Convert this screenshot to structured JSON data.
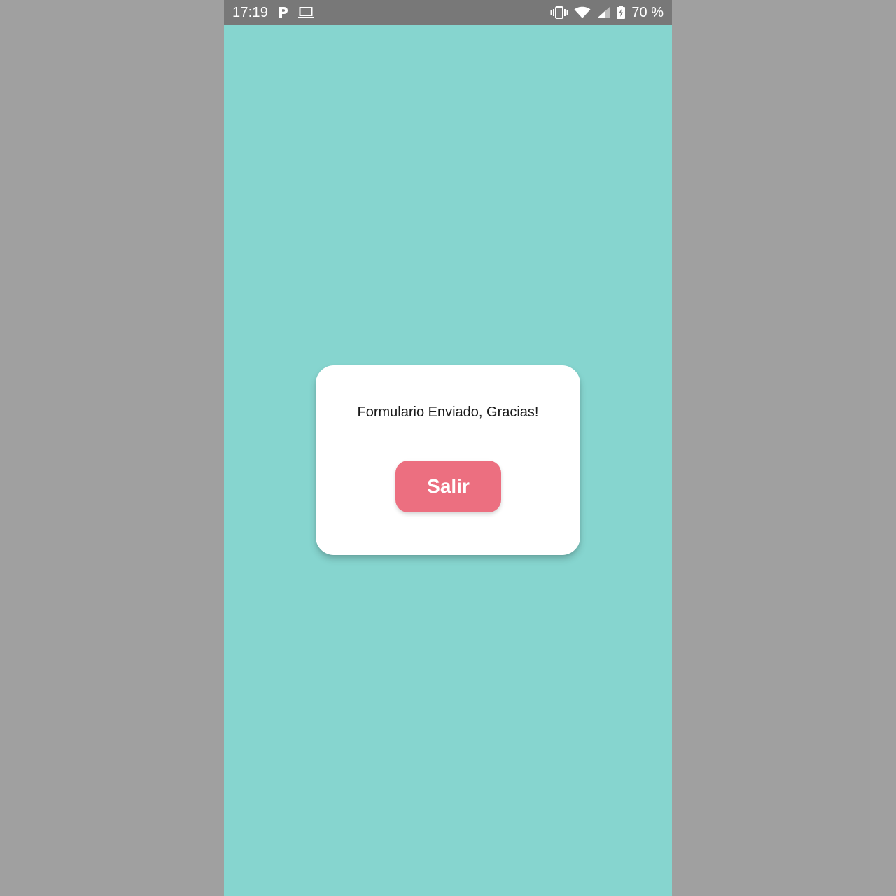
{
  "status_bar": {
    "time": "17:19",
    "left_icons": [
      "parking-icon",
      "laptop-icon"
    ],
    "right_icons": [
      "vibrate-icon",
      "wifi-icon",
      "signal-icon",
      "battery-charging-icon"
    ],
    "battery": "70 %"
  },
  "dialog": {
    "message": "Formulario Enviado, Gracias!",
    "exit_label": "Salir"
  },
  "colors": {
    "background": "#86d5cf",
    "status_bar": "#787878",
    "outer": "#a0a0a0",
    "button": "#ec6f80",
    "dialog": "#ffffff"
  }
}
